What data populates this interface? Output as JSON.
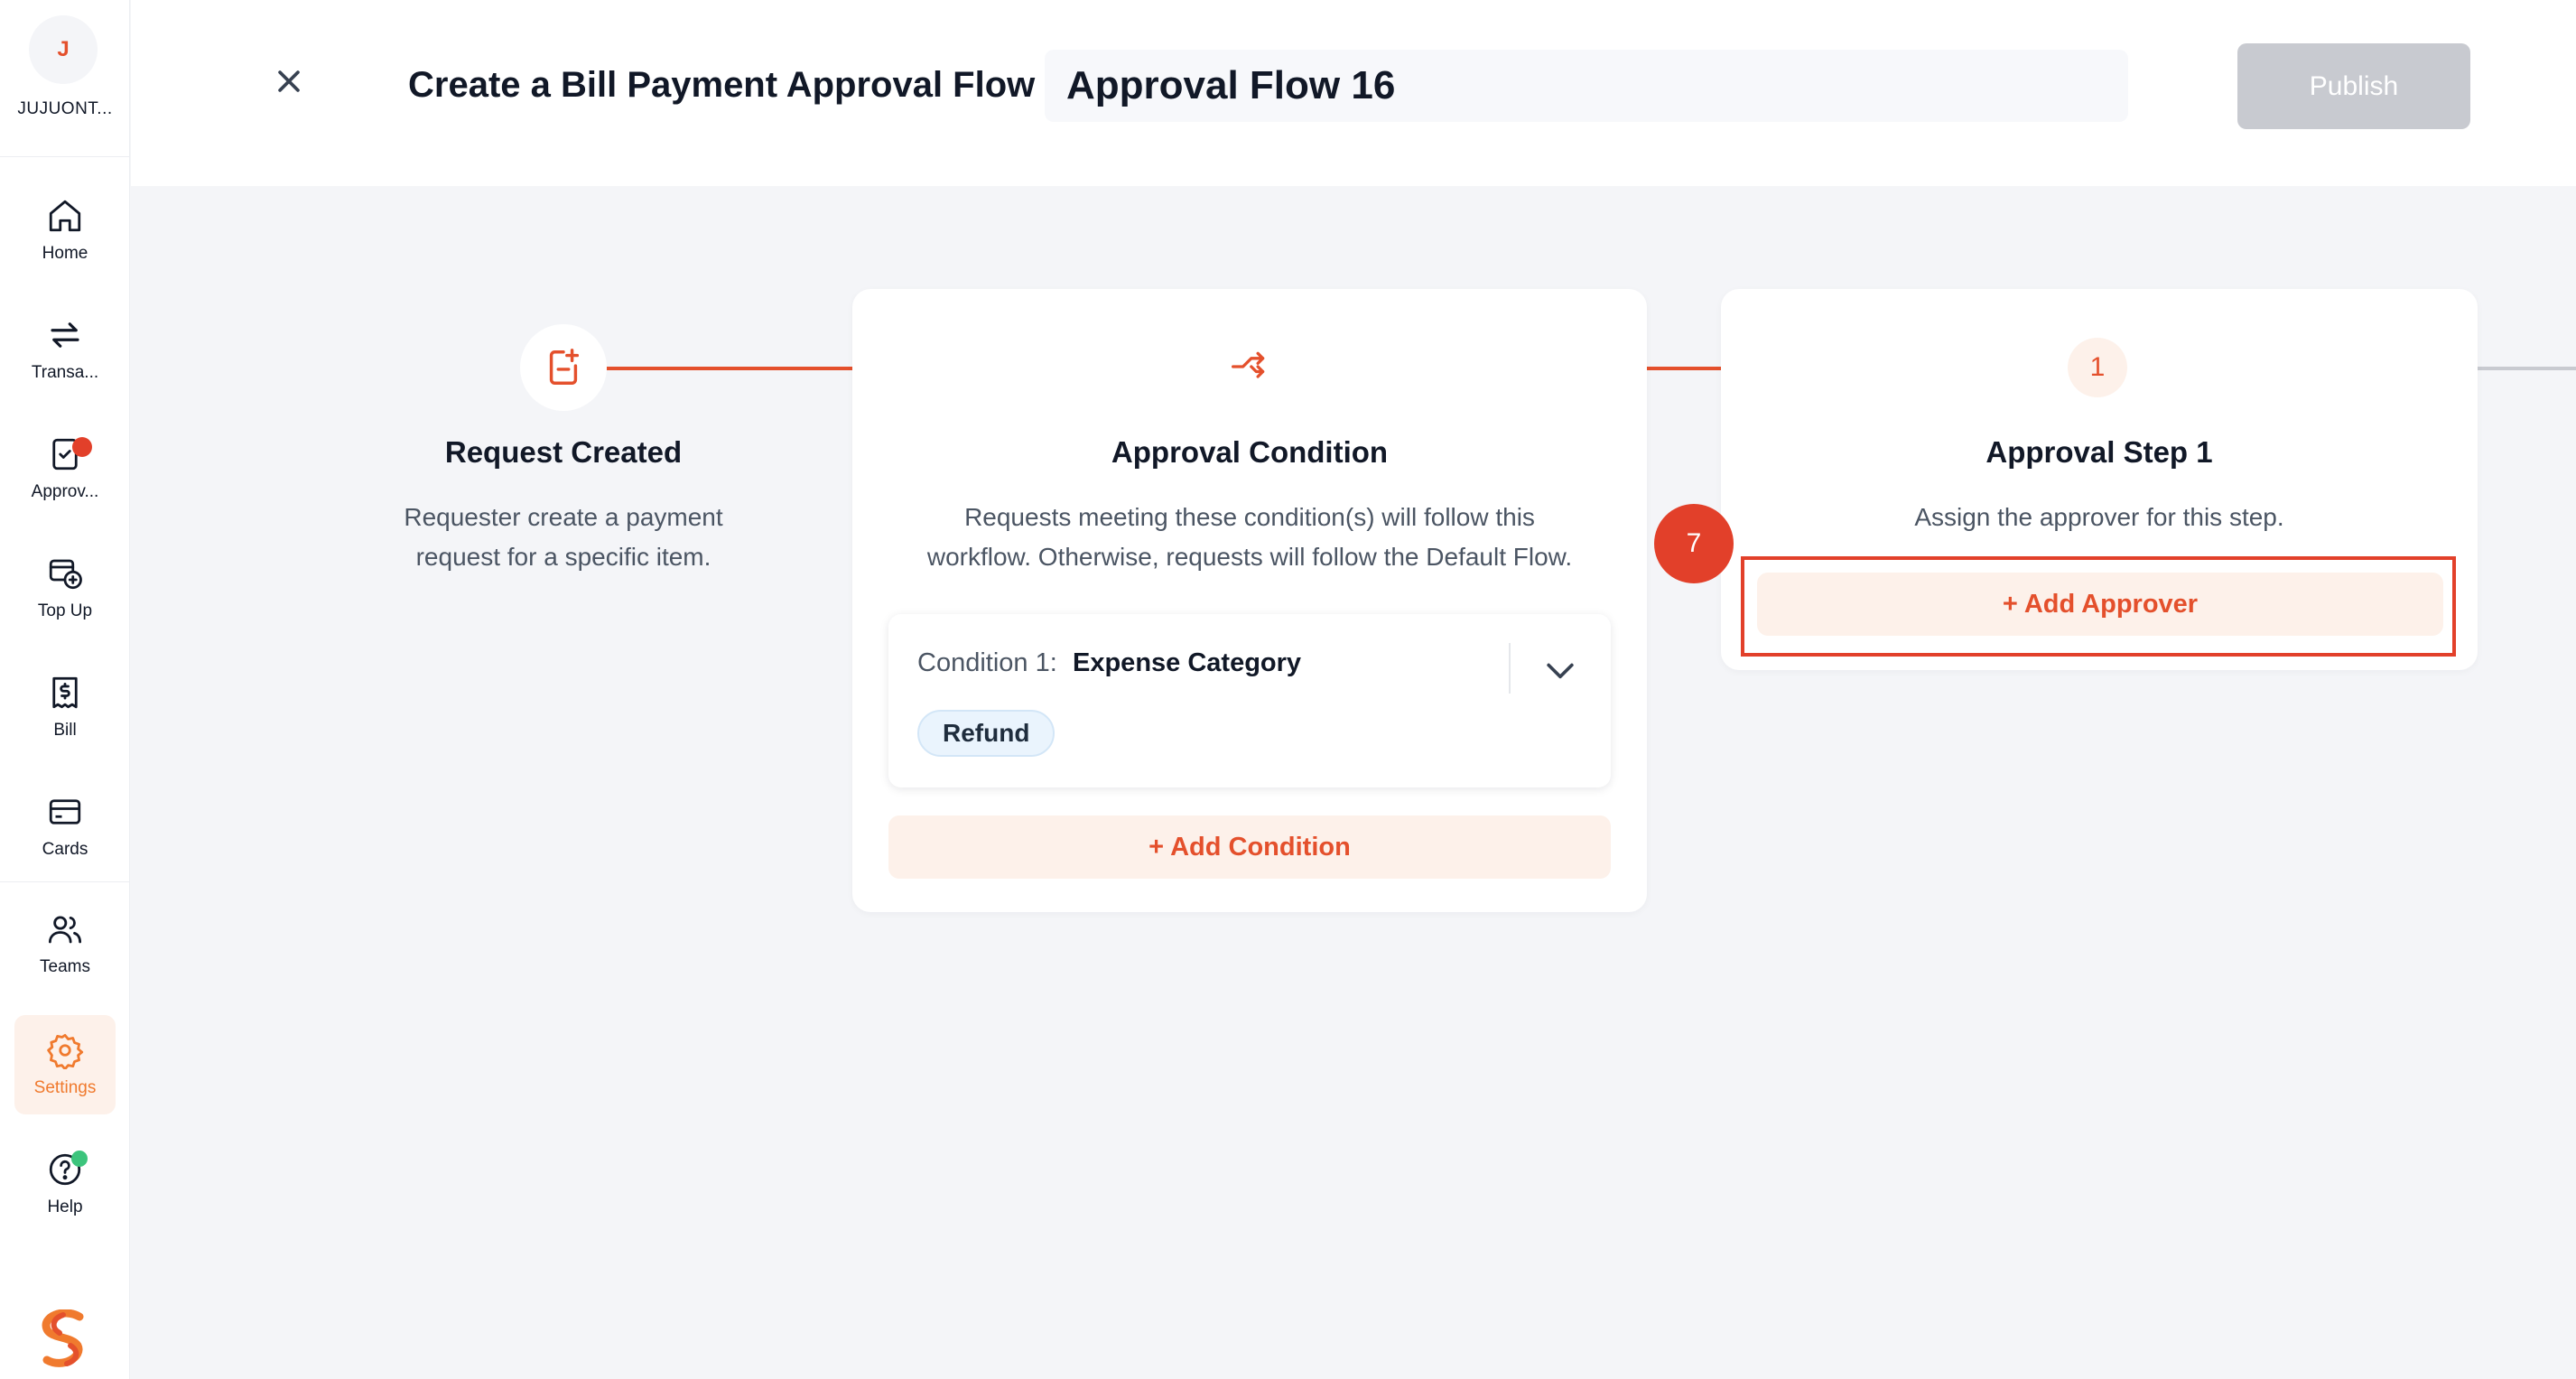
{
  "colors": {
    "accent": "#e4502c",
    "accent_soft": "#fdf1ea",
    "settings_active": "#f07a2e",
    "marker": "#e2402a",
    "publish_disabled": "#c8cad0",
    "connector_active": "#e4502c",
    "connector_inactive": "#c8cad0",
    "notification_red": "#e2402a",
    "help_green": "#3cc47c"
  },
  "sidebar": {
    "account": {
      "avatar_initial": "J",
      "name": "JUJUONT..."
    },
    "items": [
      {
        "label": "Home",
        "icon": "home-icon"
      },
      {
        "label": "Transa...",
        "icon": "transfer-arrows-icon"
      },
      {
        "label": "Approv...",
        "icon": "approval-clipboard-icon",
        "has_notification": true
      },
      {
        "label": "Top Up",
        "icon": "top-up-icon"
      },
      {
        "label": "Bill",
        "icon": "bill-receipt-icon"
      },
      {
        "label": "Cards",
        "icon": "card-icon"
      },
      {
        "label": "Teams",
        "icon": "teams-icon"
      },
      {
        "label": "Settings",
        "icon": "gear-icon",
        "active": true
      },
      {
        "label": "Help",
        "icon": "help-icon",
        "has_status": true
      }
    ],
    "logo_icon": "brand-logo-icon"
  },
  "header": {
    "close_icon": "close-icon",
    "title": "Create a Bill Payment Approval Flow",
    "flow_name_value": "Approval Flow 16",
    "publish_label": "Publish",
    "publish_disabled": true
  },
  "flow": {
    "request_created": {
      "icon": "add-document-icon",
      "title": "Request Created",
      "description_line1": "Requester create a payment",
      "description_line2": "request for a specific item."
    },
    "approval_condition": {
      "icon": "branch-arrows-icon",
      "title": "Approval Condition",
      "description_line1": "Requests meeting these condition(s) will follow this",
      "description_line2": "workflow. Otherwise, requests will follow the Default Flow.",
      "conditions": [
        {
          "label": "Condition 1:",
          "field": "Expense Category",
          "values": [
            "Refund"
          ]
        }
      ],
      "add_condition_label": "+ Add Condition"
    },
    "approval_step": {
      "number": "1",
      "title": "Approval Step 1",
      "description": "Assign the approver for this step.",
      "add_approver_label": "+ Add Approver"
    }
  },
  "annotation": {
    "marker_label": "7"
  }
}
